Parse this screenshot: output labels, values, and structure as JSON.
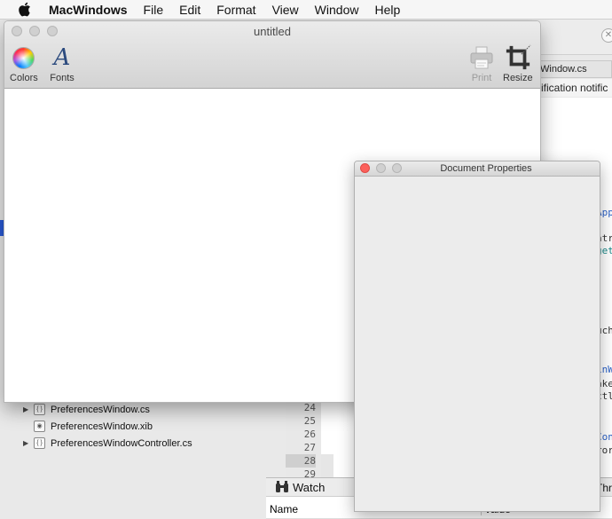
{
  "menubar": {
    "app_name": "MacWindows",
    "items": [
      "File",
      "Edit",
      "Format",
      "View",
      "Window",
      "Help"
    ]
  },
  "ide": {
    "tab_label": "Window.cs",
    "notification": "ification notific",
    "code_fragments": [
      "App",
      "ntr",
      "get",
      "uch",
      "inW",
      "ake",
      "ctl",
      "Con",
      "ror"
    ],
    "file_tree": [
      {
        "label": "PreferencesWindow.cs",
        "expandable": true
      },
      {
        "label": "PreferencesWindow.xib",
        "expandable": false
      },
      {
        "label": "PreferencesWindowController.cs",
        "expandable": true
      }
    ],
    "line_numbers": [
      "24",
      "25",
      "26",
      "27",
      "28",
      "29"
    ],
    "current_line": "28",
    "watch_label": "Watch",
    "watch_right": "Thr",
    "watch_columns": {
      "name": "Name",
      "value": "Value"
    }
  },
  "document_window": {
    "title": "untitled",
    "toolbar": {
      "colors_label": "Colors",
      "fonts_label": "Fonts",
      "fonts_glyph": "A",
      "print_label": "Print",
      "resize_label": "Resize"
    }
  },
  "properties_panel": {
    "title": "Document Properties"
  },
  "colors": {
    "close_red": "#fc605b",
    "selection_blue": "#2a5bd7",
    "code_blue": "#2d63c8",
    "code_teal": "#1a8a8a"
  }
}
